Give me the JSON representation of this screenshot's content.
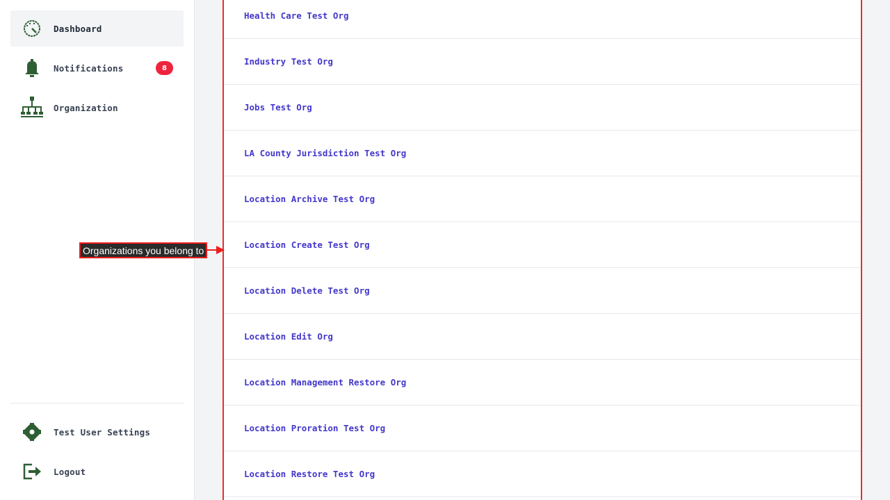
{
  "sidebar": {
    "items": [
      {
        "label": "Dashboard",
        "icon": "dashboard-gauge-icon",
        "active": true
      },
      {
        "label": "Notifications",
        "icon": "bell-icon",
        "badge": "8"
      },
      {
        "label": "Organization",
        "icon": "org-chart-icon"
      }
    ],
    "bottom_items": [
      {
        "label": "Test User Settings",
        "icon": "gear-icon"
      },
      {
        "label": "Logout",
        "icon": "logout-icon"
      }
    ]
  },
  "organizations": [
    "Health Care Test Org",
    "Industry Test Org",
    "Jobs Test Org",
    "LA County Jurisdiction Test Org",
    "Location Archive Test Org",
    "Location Create Test Org",
    "Location Delete Test Org",
    "Location Edit Org",
    "Location Management Restore Org",
    "Location Proration Test Org",
    "Location Restore Test Org"
  ],
  "annotation": {
    "text": "Organizations you belong to"
  },
  "colors": {
    "icon_green": "#2e5e33",
    "link": "#4338ca",
    "badge": "#ef233c",
    "highlight": "#ef2b2b"
  }
}
